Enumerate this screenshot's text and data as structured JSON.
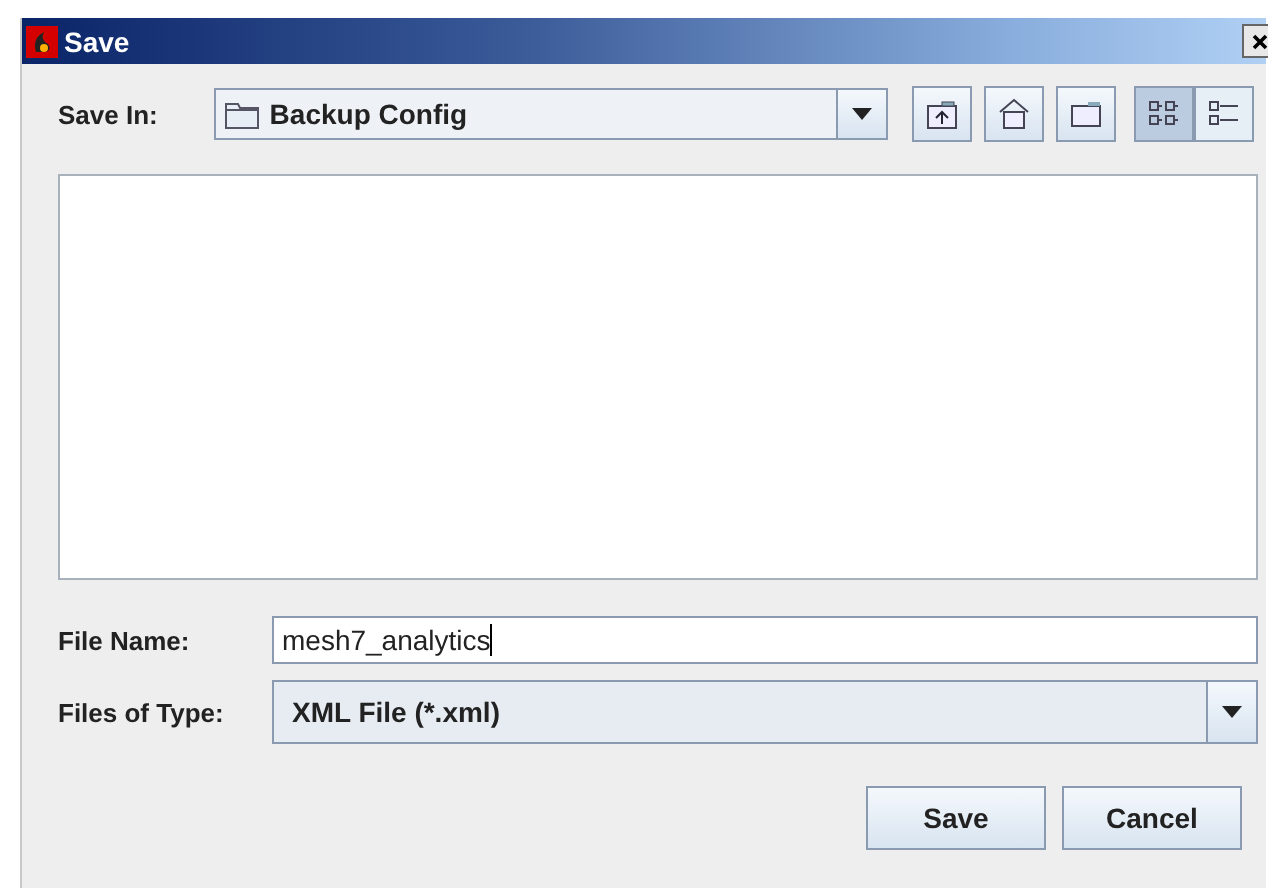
{
  "window": {
    "title": "Save"
  },
  "save_in": {
    "label": "Save In:",
    "value": "Backup Config"
  },
  "toolbar": [
    {
      "kind": "up"
    },
    {
      "kind": "home"
    },
    {
      "kind": "new-folder"
    }
  ],
  "view_toggles": [
    {
      "kind": "list",
      "selected": true
    },
    {
      "kind": "details",
      "selected": false
    }
  ],
  "file_name": {
    "label": "File Name:",
    "value": "mesh7_analytics"
  },
  "files_of_type": {
    "label": "Files of Type:",
    "value": "XML File (*.xml)"
  },
  "buttons": [
    "Save",
    "Cancel"
  ]
}
